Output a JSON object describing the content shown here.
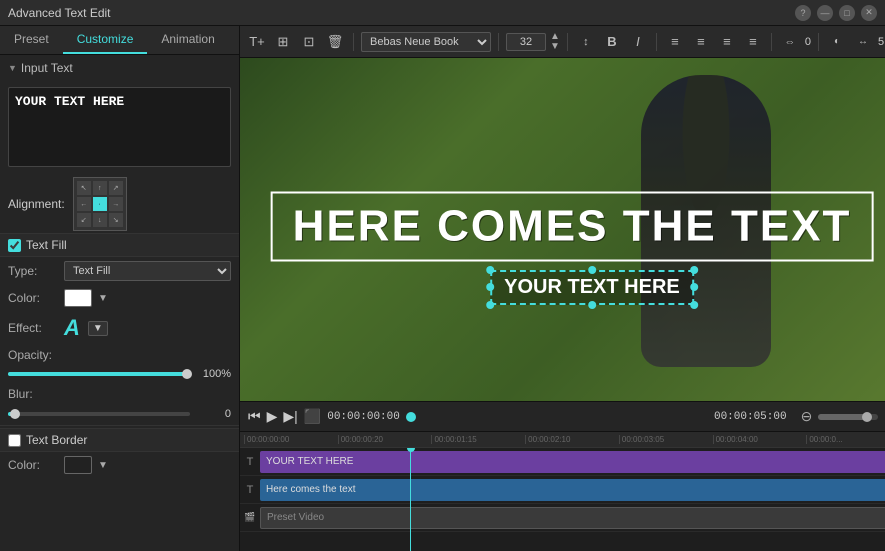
{
  "window": {
    "title": "Advanced Text Edit",
    "controls": [
      "?",
      "—",
      "□",
      "✕"
    ]
  },
  "tabs": {
    "items": [
      "Preset",
      "Customize",
      "Animation"
    ],
    "active": 1
  },
  "left_panel": {
    "input_text_section": "Input Text",
    "input_text_value": "YOUR TEXT HERE",
    "alignment_label": "Alignment:",
    "text_fill_label": "Text Fill",
    "text_fill_checked": true,
    "type_label": "Type:",
    "type_value": "Text Fill",
    "color_label": "Color:",
    "effect_label": "Effect:",
    "effect_letter": "A",
    "opacity_label": "Opacity:",
    "opacity_value": "100%",
    "blur_label": "Blur:",
    "blur_value": "0",
    "text_border_label": "Text Border",
    "text_border_color_label": "Color:"
  },
  "toolbar": {
    "font": "Bebas Neue Book",
    "font_size": "32",
    "buttons": [
      "T+",
      "⊞",
      "⊡",
      "🗑"
    ],
    "format_buttons": [
      "B",
      "I"
    ],
    "align_buttons": [
      "≡",
      "≡",
      "≡",
      "≡"
    ],
    "extra_controls": [
      "0",
      "5"
    ]
  },
  "video": {
    "big_text": "HERE COMES THE TEXT",
    "small_text": "YOUR TEXT HERE",
    "subtitle_preview": "Here comes the text"
  },
  "playback": {
    "current_time": "00:00:00:00",
    "duration": "00:00:05:00"
  },
  "timeline": {
    "ruler_marks": [
      "00:00:00:00",
      "00:00:00:20",
      "00:00:01:15",
      "00:00:02:10",
      "00:00:03:05",
      "00:00:04:00",
      "00:00:0"
    ],
    "tracks": [
      {
        "icon": "T",
        "clip_text": "YOUR TEXT HERE",
        "clip_type": "purple",
        "left": "0%",
        "width": "100%"
      },
      {
        "icon": "T",
        "clip_text": "Here comes the text",
        "clip_type": "blue",
        "left": "0%",
        "width": "100%"
      },
      {
        "icon": "🎬",
        "clip_text": "Preset Video",
        "clip_type": "dark",
        "left": "0%",
        "width": "100%"
      }
    ]
  }
}
